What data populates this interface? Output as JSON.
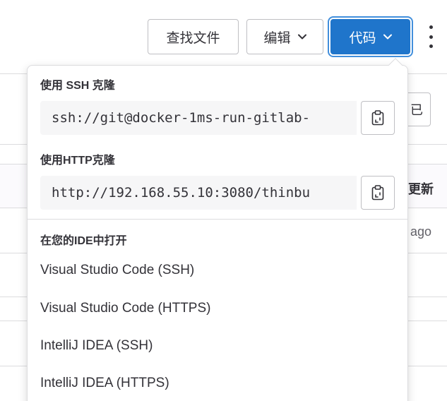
{
  "toolbar": {
    "find_file_label": "查找文件",
    "edit_label": "编辑",
    "code_label": "代码",
    "accent_color": "#1f75cb"
  },
  "background": {
    "partial_button_char": "已",
    "partial_header_text": "更新",
    "partial_row_text": "ago"
  },
  "dropdown": {
    "ssh": {
      "title": "使用 SSH 克隆",
      "url": "ssh://git@docker-1ms-run-gitlab-"
    },
    "http": {
      "title": "使用HTTP克隆",
      "url": "http://192.168.55.10:3080/thinbu"
    },
    "ide": {
      "title": "在您的IDE中打开",
      "items": [
        "Visual Studio Code (SSH)",
        "Visual Studio Code (HTTPS)",
        "IntelliJ IDEA (SSH)",
        "IntelliJ IDEA (HTTPS)"
      ]
    }
  },
  "icons": {
    "copy": "clipboard-icon",
    "chevron": "chevron-down-icon",
    "more": "kebab-icon"
  }
}
